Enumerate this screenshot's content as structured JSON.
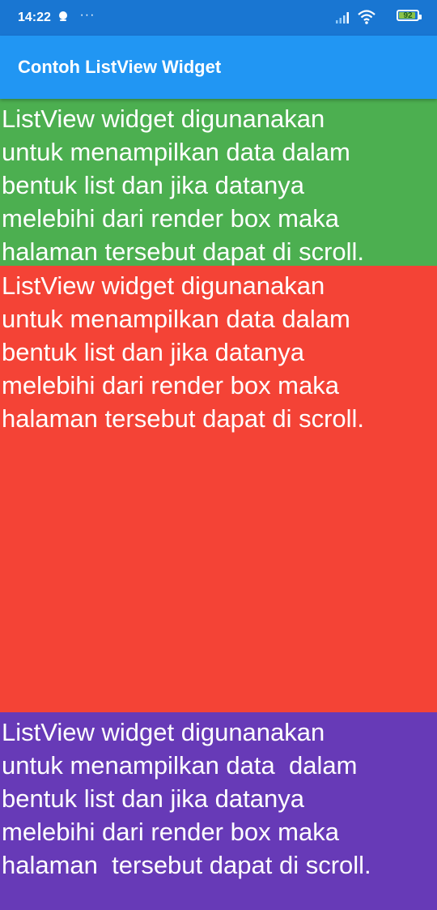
{
  "status_bar": {
    "time": "14:22",
    "dots": "···",
    "battery_level": "92",
    "battery_fraction": 0.92,
    "colors": {
      "background": "#1976D2",
      "battery_fill": "#8BC34A"
    }
  },
  "app_bar": {
    "title": "Contoh ListView Widget",
    "color": "#2196F3"
  },
  "list": {
    "items": [
      {
        "text": "ListView widget digunanakan\nuntuk menampilkan data dalam\nbentuk list dan jika datanya\nmelebihi dari render box maka\nhalaman tersebut dapat di scroll.",
        "color": "#4CAF50"
      },
      {
        "text": "ListView widget digunanakan\nuntuk menampilkan data dalam\nbentuk list dan jika datanya\nmelebihi dari render box maka\nhalaman tersebut dapat di scroll.",
        "color": "#F44336"
      },
      {
        "text": "ListView widget digunanakan\nuntuk menampilkan data  dalam\nbentuk list dan jika datanya\nmelebihi dari render box maka\nhalaman  tersebut dapat di scroll.",
        "color": "#673AB7"
      }
    ]
  },
  "icons": {
    "notification": "notification-icon",
    "signal": "signal-icon",
    "wifi": "wifi-icon",
    "battery": "battery-icon"
  }
}
